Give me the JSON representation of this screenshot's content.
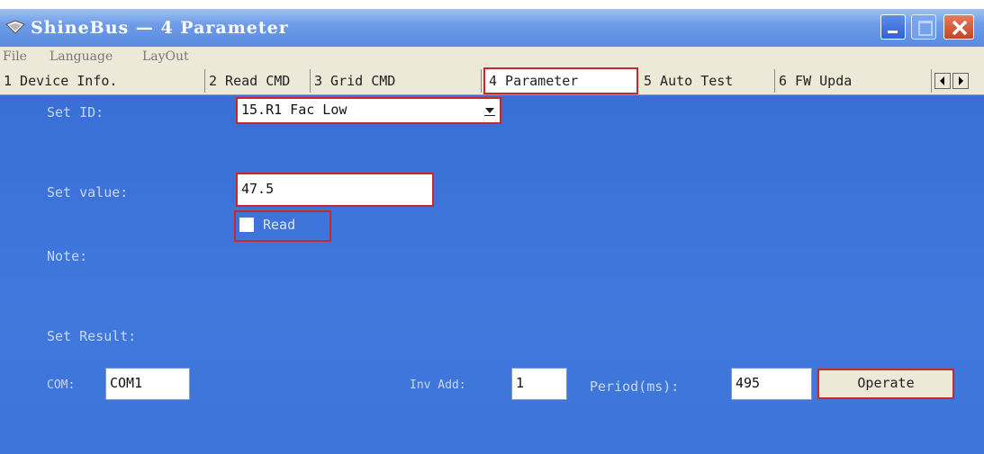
{
  "window": {
    "title": "ShineBus — 4 Parameter",
    "colors": {
      "title_bar": "#6e9ce8",
      "background": "#3e73d8",
      "highlight": "#c8282a"
    }
  },
  "menu": [
    "File",
    "Language",
    "LayOut"
  ],
  "tabs": [
    {
      "label": "1 Device Info."
    },
    {
      "label": "2 Read CMD"
    },
    {
      "label": "3 Grid CMD"
    },
    {
      "label": "4 Parameter",
      "active": true
    },
    {
      "label": "5 Auto Test"
    },
    {
      "label": "6 FW Upda"
    }
  ],
  "tab_scroll": {
    "left_icon": "arrow-left",
    "right_icon": "arrow-right"
  },
  "form": {
    "set_id_label": "Set ID:",
    "set_id_value": "15.R1 Fac Low",
    "set_value_label": "Set value:",
    "set_value": "47.5",
    "read_label": "Read",
    "note_label": "Note:",
    "set_result_label": "Set Result:"
  },
  "footer": {
    "com_label": "COM:",
    "com_value": "COM1",
    "inv_add_label": "Inv Add:",
    "inv_add_value": "1",
    "period_label": "Period(ms):",
    "period_value": "495",
    "operate_label": "Operate"
  }
}
